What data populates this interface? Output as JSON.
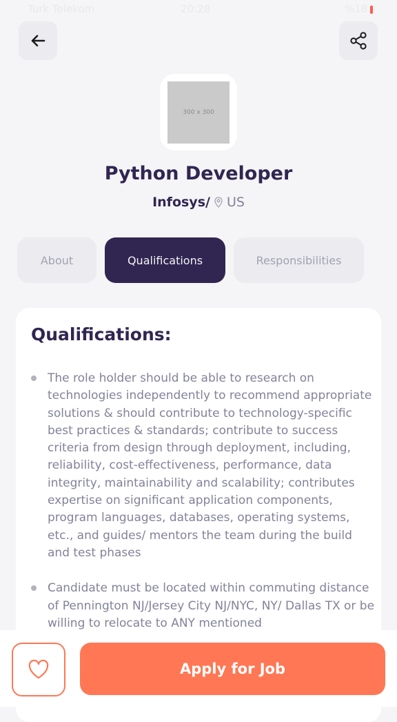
{
  "status_bar": {
    "carrier": "Turk Telekom",
    "time": "20:28",
    "battery": "%18"
  },
  "header": {
    "back_icon": "arrow-left-icon",
    "share_icon": "share-icon"
  },
  "company": {
    "logo_placeholder": "300 x 300",
    "job_title": "Python Developer",
    "name": "Infosys/",
    "location": "US"
  },
  "tabs": [
    {
      "label": "About"
    },
    {
      "label": "Qualifications"
    },
    {
      "label": "Responsibilities"
    }
  ],
  "active_tab": "Qualifications",
  "qualifications": {
    "title": "Qualifications:",
    "items": [
      "The role holder should be able to research on technologies independently to recommend appropriate solutions & should contribute to technology-specific best practices & standards; contribute to success criteria from design through deployment, including, reliability, cost-effectiveness, performance, data integrity, maintainability and scalability; contributes expertise on significant application components, program languages, databases, operating systems, etc., and guides/ mentors the team during the build and test phases",
      "Candidate must be located within commuting distance of Pennington NJ/Jersey City NJ/NYC, NY/ Dallas TX or be willing to relocate to ANY mentioned"
    ]
  },
  "footer": {
    "favorite_icon": "heart-icon",
    "apply_label": "Apply for Job"
  },
  "colors": {
    "primary": "#312651",
    "accent": "#ff7754",
    "muted": "#83829a",
    "background": "#f5f5f7"
  }
}
